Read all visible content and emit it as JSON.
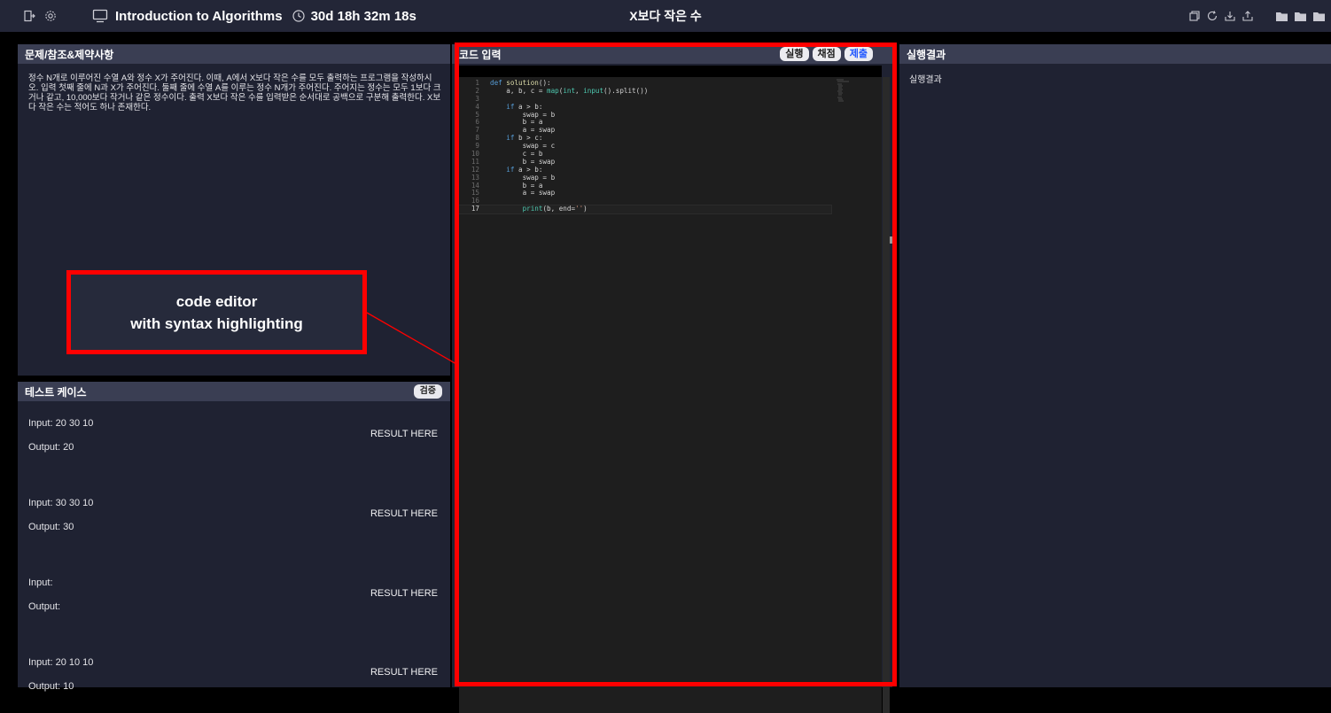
{
  "topbar": {
    "course_title": "Introduction to Algorithms",
    "timer": "30d 18h 32m 18s",
    "problem_title": "X보다 작은 수",
    "right_icons": [
      "copy-icon",
      "refresh-icon",
      "download-icon",
      "upload-icon",
      "folder-icon",
      "folder-icon",
      "folder-icon"
    ]
  },
  "problem_panel": {
    "header": "문제/참조&제약사항",
    "text": "정수 N개로 이루어진 수열 A와 정수 X가 주어진다. 이때, A에서 X보다 작은 수를 모두 출력하는 프로그램을 작성하시오. 입력 첫째 줄에 N과 X가 주어진다. 둘째 줄에 수열 A를 이루는 정수 N개가 주어진다. 주어지는 정수는 모두 1보다 크거나 같고, 10,000보다 작거나 같은 정수이다. 출력 X보다 작은 수를 입력받은 순서대로 공백으로 구분해 출력한다. X보다 작은 수는 적어도 하나 존재한다."
  },
  "testcases_panel": {
    "header": "테스트 케이스",
    "verify_label": "검증",
    "cases": [
      {
        "input": "Input: 20 30 10",
        "output": "Output: 20",
        "result": "RESULT HERE"
      },
      {
        "input": "Input: 30 30 10",
        "output": "Output: 30",
        "result": "RESULT HERE"
      },
      {
        "input": "Input:",
        "output": "Output:",
        "result": "RESULT HERE"
      },
      {
        "input": "Input: 20 10 10",
        "output": "Output: 10",
        "result": "RESULT HERE"
      }
    ]
  },
  "editor_panel": {
    "header": "코드 입력",
    "buttons": {
      "run": "실행",
      "grade": "채점",
      "submit": "제출"
    },
    "lines": [
      "def solution():",
      "    a, b, c = map(int, input().split())",
      "",
      "    if a > b:",
      "        swap = b",
      "        b = a",
      "        a = swap",
      "    if b > c:",
      "        swap = c",
      "        c = b",
      "        b = swap",
      "    if a > b:",
      "        swap = b",
      "        b = a",
      "        a = swap",
      "",
      "        print(b, end='')"
    ]
  },
  "result_panel": {
    "header": "실행결과",
    "body": "실행결과"
  },
  "annotation": {
    "line1": "code editor",
    "line2": "with syntax highlighting",
    "color": "#ff0000"
  },
  "colors": {
    "topbar": "#232637",
    "panel": "#1f2232",
    "panel_header": "#3a3e53",
    "editor_bg": "#1e1e1e",
    "submit_text": "#1f55ff"
  }
}
